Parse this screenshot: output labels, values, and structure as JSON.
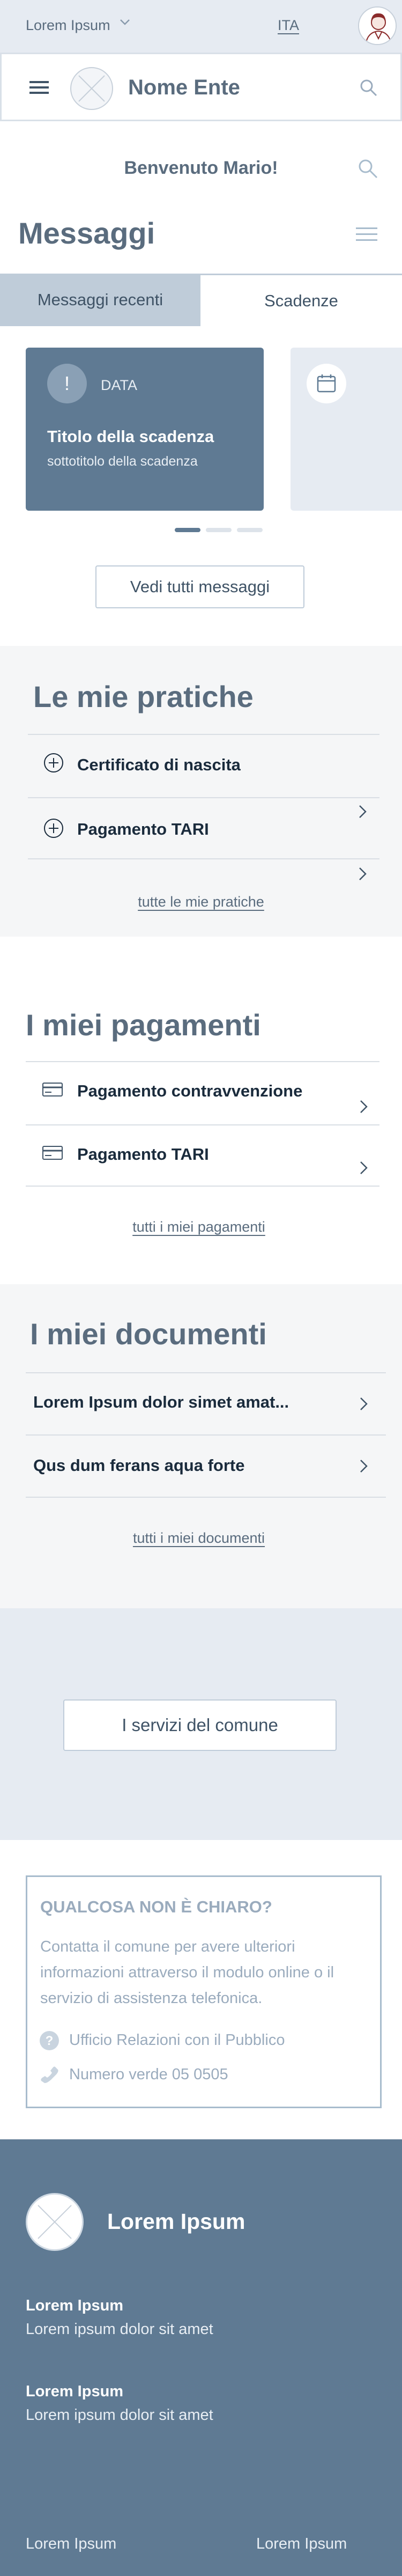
{
  "topbar": {
    "ente_select": "Lorem Ipsum",
    "language": "ITA"
  },
  "header": {
    "title": "Nome Ente"
  },
  "welcome": "Benvenuto Mario!",
  "messages": {
    "title": "Messaggi",
    "tabs": [
      "Messaggi recenti",
      "Scadenze"
    ],
    "active_tab": "Scadenze",
    "card": {
      "icon_text": "!",
      "date_label": "DATA",
      "title": "Titolo della scadenza",
      "subtitle": "sottotitolo della scadenza"
    },
    "carousel_pages": 3,
    "carousel_active": 1,
    "see_all": "Vedi tutti messaggi"
  },
  "pratiche": {
    "title": "Le mie pratiche",
    "items": [
      {
        "label": "Certificato di nascita",
        "icon": "plus-circle-icon"
      },
      {
        "label": "Pagamento TARI",
        "icon": "plus-circle-icon"
      }
    ],
    "link": "tutte le mie pratiche"
  },
  "pagamenti": {
    "title": "I miei pagamenti",
    "items": [
      {
        "label": "Pagamento contravvenzione",
        "icon": "credit-card-icon"
      },
      {
        "label": "Pagamento TARI",
        "icon": "credit-card-icon"
      }
    ],
    "link": "tutti i miei pagamenti"
  },
  "documenti": {
    "title": "I miei documenti",
    "items": [
      {
        "label": "Lorem Ipsum dolor simet amat..."
      },
      {
        "label": "Qus dum ferans aqua forte"
      }
    ],
    "link": "tutti i miei documenti"
  },
  "servizi_button": "I servizi del comune",
  "help": {
    "title": "QUALCOSA NON È CHIARO?",
    "text": "Contatta il comune per avere ulteriori informazioni attraverso il modulo online o il servizio di assistenza telefonica.",
    "office": "Ufficio Relazioni con il Pubblico",
    "phone": "Numero verde 05 0505"
  },
  "footer": {
    "name": "Lorem Ipsum",
    "blocks": [
      {
        "title": "Lorem Ipsum",
        "text": "Lorem ipsum dolor sit amet"
      },
      {
        "title": "Lorem Ipsum",
        "text": "Lorem ipsum dolor sit amet"
      }
    ],
    "bottom_left": "Lorem Ipsum",
    "bottom_right": "Lorem Ipsum"
  },
  "colors": {
    "primary": "#5f7a93",
    "light_bg": "#e6ebf2",
    "tab_active_bg": "#bfccd9",
    "text_muted": "#5a6c7e"
  }
}
